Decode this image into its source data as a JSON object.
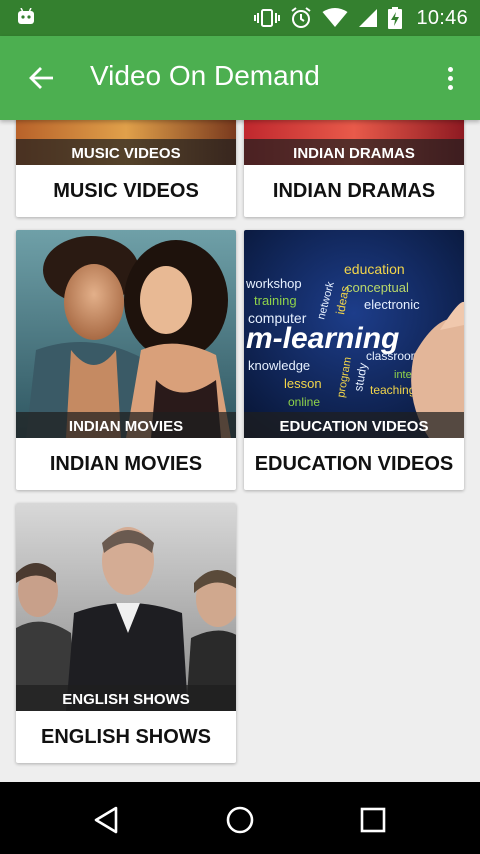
{
  "status_bar": {
    "time": "10:46",
    "icons": [
      "android-debug-icon",
      "vibrate-icon",
      "alarm-icon",
      "wifi-icon",
      "signal-icon",
      "battery-charging-icon"
    ]
  },
  "app_bar": {
    "title": "Video On Demand",
    "back_icon": "arrow-back-icon",
    "menu_icon": "more-vert-icon"
  },
  "categories": [
    {
      "title": "MUSIC VIDEOS",
      "overlay": "MUSIC VIDEOS"
    },
    {
      "title": "INDIAN DRAMAS",
      "overlay": "INDIAN DRAMAS"
    },
    {
      "title": "INDIAN MOVIES",
      "overlay": "INDIAN MOVIES"
    },
    {
      "title": "EDUCATION VIDEOS",
      "overlay": "EDUCATION VIDEOS"
    },
    {
      "title": "ENGLISH SHOWS",
      "overlay": "ENGLISH SHOWS"
    }
  ],
  "education_words": [
    "workshop",
    "education",
    "training",
    "network",
    "conceptual",
    "computer",
    "ideas",
    "electronic",
    "m-learning",
    "knowledge",
    "program",
    "study",
    "classroom",
    "lesson",
    "internet",
    "online",
    "teaching"
  ],
  "nav_bar": {
    "back_icon": "nav-back-icon",
    "home_icon": "nav-home-icon",
    "recents_icon": "nav-recents-icon"
  },
  "colors": {
    "status_bar": "#34802f",
    "app_bar": "#4caf50",
    "background": "#eeeeee",
    "nav_bar": "#000000"
  }
}
